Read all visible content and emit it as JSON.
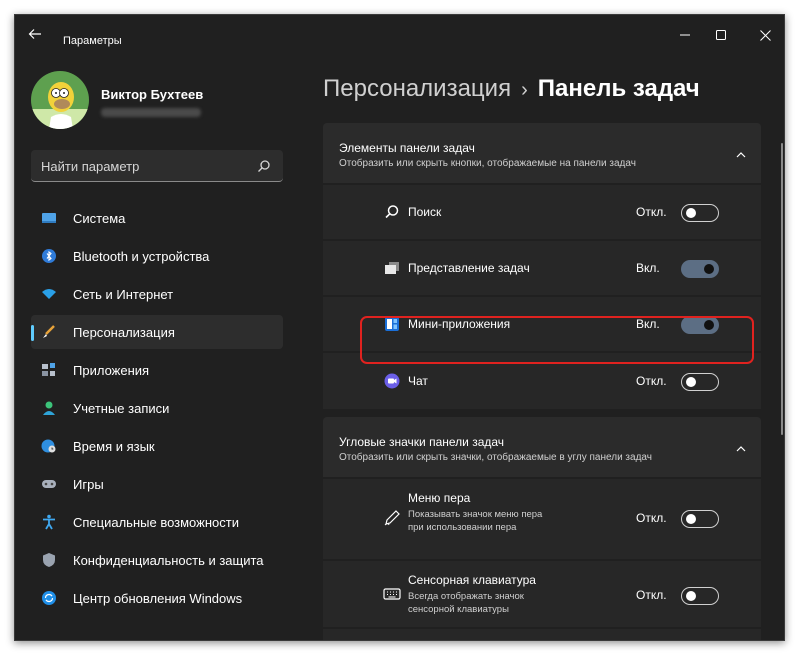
{
  "window": {
    "title": "Параметры"
  },
  "profile": {
    "name": "Виктор Бухтеев"
  },
  "search": {
    "placeholder": "Найти параметр"
  },
  "breadcrumb": {
    "parent": "Персонализация",
    "separator": "›",
    "current": "Панель задач"
  },
  "nav": [
    {
      "label": "Система",
      "icon": "monitor-icon"
    },
    {
      "label": "Bluetooth и устройства",
      "icon": "bluetooth-icon"
    },
    {
      "label": "Сеть и Интернет",
      "icon": "wifi-icon"
    },
    {
      "label": "Персонализация",
      "icon": "brush-icon",
      "selected": true
    },
    {
      "label": "Приложения",
      "icon": "apps-icon"
    },
    {
      "label": "Учетные записи",
      "icon": "person-icon"
    },
    {
      "label": "Время и язык",
      "icon": "globe-clock-icon"
    },
    {
      "label": "Игры",
      "icon": "gamepad-icon"
    },
    {
      "label": "Специальные возможности",
      "icon": "accessibility-icon"
    },
    {
      "label": "Конфиденциальность и защита",
      "icon": "shield-icon"
    },
    {
      "label": "Центр обновления Windows",
      "icon": "update-icon"
    }
  ],
  "sections": [
    {
      "title": "Элементы панели задач",
      "desc": "Отобразить или скрыть кнопки, отображаемые на панели задач",
      "items": [
        {
          "label": "Поиск",
          "state": "Откл.",
          "on": false,
          "icon": "search-icon"
        },
        {
          "label": "Представление задач",
          "state": "Вкл.",
          "on": true,
          "icon": "task-view-icon"
        },
        {
          "label": "Мини-приложения",
          "state": "Вкл.",
          "on": true,
          "icon": "widgets-icon"
        },
        {
          "label": "Чат",
          "state": "Откл.",
          "on": false,
          "icon": "chat-icon"
        }
      ]
    },
    {
      "title": "Угловые значки панели задач",
      "desc": "Отобразить или скрыть значки, отображаемые в углу панели задач",
      "items": [
        {
          "label": "Меню пера",
          "sublabel": "Показывать значок меню пера при использовании пера",
          "state": "Откл.",
          "on": false,
          "icon": "pen-icon"
        },
        {
          "label": "Сенсорная клавиатура",
          "sublabel": "Всегда отображать значок сенсорной клавиатуры",
          "state": "Откл.",
          "on": false,
          "icon": "keyboard-icon"
        }
      ]
    }
  ],
  "colors": {
    "accent": "#60cdff",
    "highlight": "#e0221f",
    "background": "#202020",
    "card": "#272727"
  }
}
